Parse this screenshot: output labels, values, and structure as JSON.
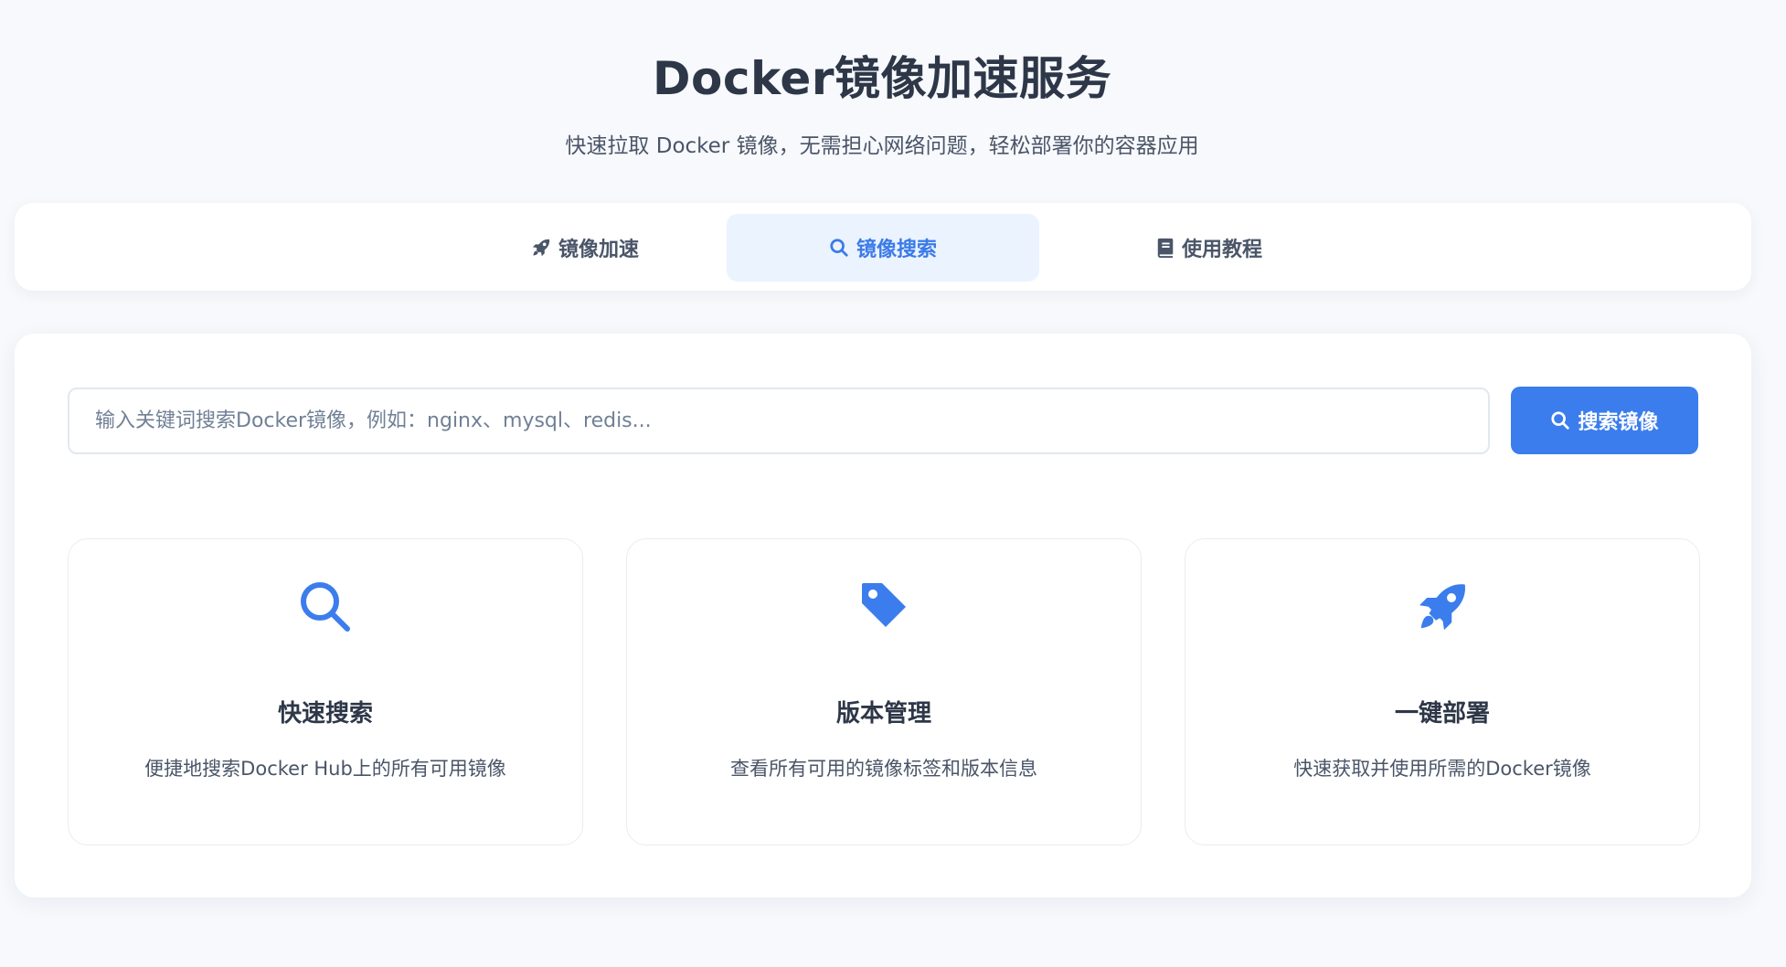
{
  "header": {
    "title": "Docker镜像加速服务",
    "subtitle": "快速拉取 Docker 镜像，无需担心网络问题，轻松部署你的容器应用"
  },
  "tabs": [
    {
      "label": "镜像加速",
      "icon": "rocket-icon",
      "active": false
    },
    {
      "label": "镜像搜索",
      "icon": "search-icon",
      "active": true
    },
    {
      "label": "使用教程",
      "icon": "book-icon",
      "active": false
    }
  ],
  "search": {
    "placeholder": "输入关键词搜索Docker镜像，例如：nginx、mysql、redis...",
    "value": "",
    "button_label": "搜索镜像"
  },
  "features": [
    {
      "icon": "search-icon",
      "title": "快速搜索",
      "description": "便捷地搜索Docker Hub上的所有可用镜像"
    },
    {
      "icon": "tag-icon",
      "title": "版本管理",
      "description": "查看所有可用的镜像标签和版本信息"
    },
    {
      "icon": "rocket-icon",
      "title": "一键部署",
      "description": "快速获取并使用所需的Docker镜像"
    }
  ],
  "colors": {
    "accent": "#3b7ded",
    "active_tab_bg": "#ebf3fe",
    "page_bg": "#f7f9fc",
    "text_primary": "#2d3748",
    "text_secondary": "#4a5568"
  }
}
